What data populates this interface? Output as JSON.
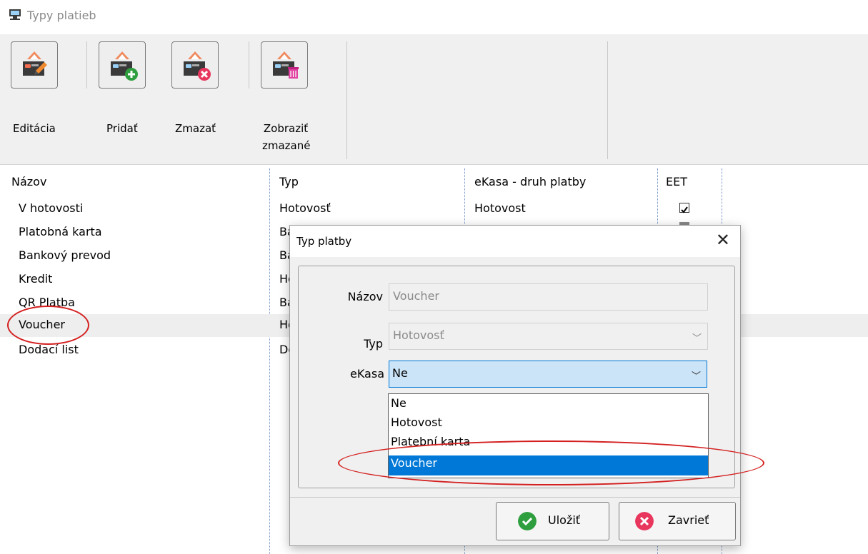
{
  "window": {
    "title": "Typy platieb",
    "icon": "payment-app-icon"
  },
  "toolbar": {
    "buttons": [
      {
        "label": "Editácia",
        "icon": "edit-payment-icon"
      },
      {
        "label": "Pridať",
        "icon": "add-payment-icon"
      },
      {
        "label": "Zmazať",
        "icon": "delete-payment-icon"
      },
      {
        "label_line1": "Zobraziť",
        "label_line2": "zmazané",
        "icon": "show-deleted-icon"
      }
    ]
  },
  "grid": {
    "columns": [
      "Názov",
      "Typ",
      "eKasa - druh platby",
      "EET"
    ],
    "rows": [
      {
        "name": "V hotovosti",
        "type": "Hotovosť",
        "ekasa": "Hotovost",
        "eet": true
      },
      {
        "name": "Platobná karta",
        "type": "Ba",
        "ekasa": "",
        "eet": null
      },
      {
        "name": "Bankový prevod",
        "type": "Ba",
        "ekasa": "",
        "eet": null
      },
      {
        "name": "Kredit",
        "type": "Ho",
        "ekasa": "",
        "eet": null
      },
      {
        "name": "QR Platba",
        "type": "Ba",
        "ekasa": "",
        "eet": null
      },
      {
        "name": "Voucher",
        "type": "Ho",
        "ekasa": "",
        "eet": null,
        "selected": true
      },
      {
        "name": "Dodací list",
        "type": "Do",
        "ekasa": "",
        "eet": null
      }
    ]
  },
  "dialog": {
    "title": "Typ platby",
    "close_icon": "close-icon",
    "fields": {
      "name_label": "Názov",
      "name_value": "Voucher",
      "type_label": "Typ",
      "type_value": "Hotovosť",
      "ekasa_label": "eKasa",
      "ekasa_value": "Ne"
    },
    "dropdown_options": [
      "Ne",
      "Hotovost",
      "Platební karta",
      "Voucher"
    ],
    "dropdown_selected": "Voucher",
    "save_label": "Uložiť",
    "close_label": "Zavrieť"
  },
  "colors": {
    "accent": "#0078d7",
    "highlight_circle": "#d42020",
    "save_icon": "#2e9e3e",
    "close_icon": "#e8365d",
    "selected_row": "#eeeeee"
  }
}
